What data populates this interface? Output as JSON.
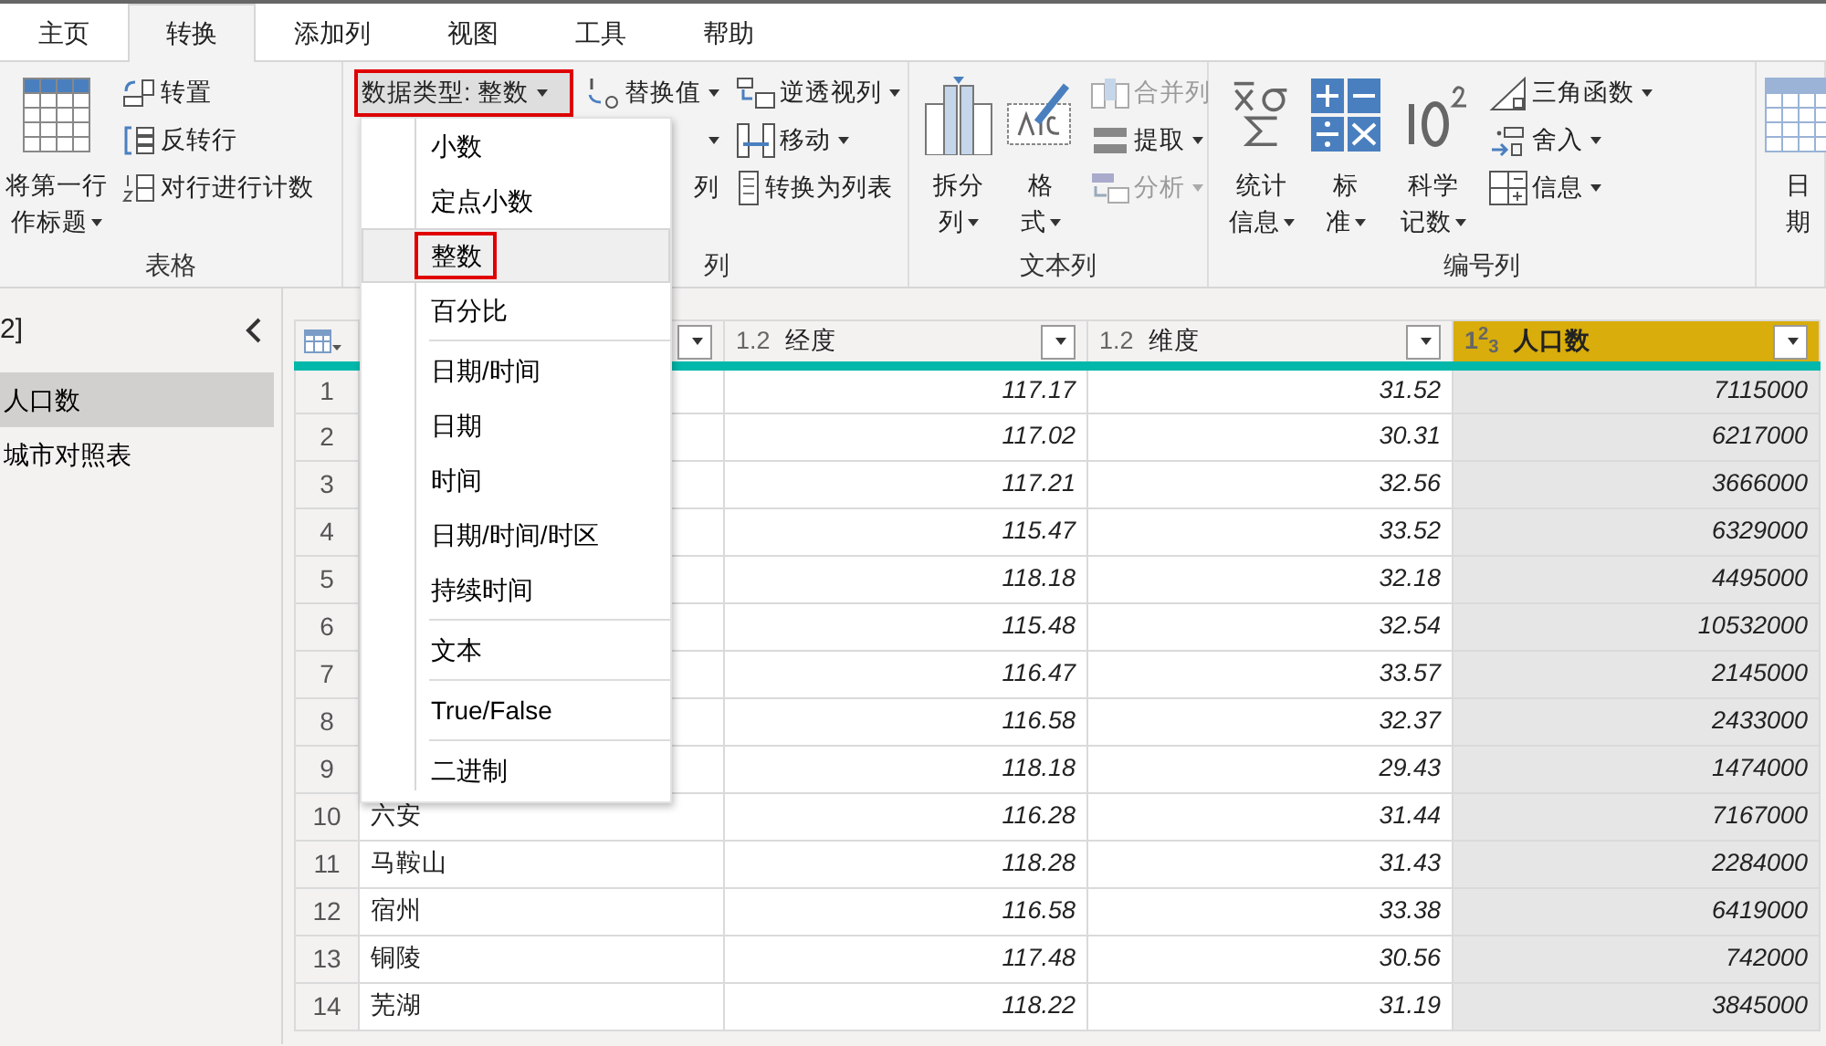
{
  "tabs": [
    {
      "label": "主页",
      "selected": false
    },
    {
      "label": "转换",
      "selected": true
    },
    {
      "label": "添加列",
      "selected": false
    },
    {
      "label": "视图",
      "selected": false
    },
    {
      "label": "工具",
      "selected": false
    },
    {
      "label": "帮助",
      "selected": false
    }
  ],
  "ribbon_groups": [
    {
      "label": "表格",
      "items": [
        {
          "kind": "large",
          "lines": [
            "将第一行",
            "作标题"
          ],
          "caret": true,
          "disabled": false
        },
        {
          "kind": "stack",
          "entries": [
            {
              "label": "转置",
              "caret": false,
              "disabled": false
            },
            {
              "label": "反转行",
              "caret": false,
              "disabled": false
            },
            {
              "label": "对行进行计数",
              "caret": false,
              "disabled": false
            }
          ]
        }
      ]
    },
    {
      "label": "列",
      "items": [
        {
          "kind": "stack",
          "entries": [
            {
              "label": "数据类型: 整数",
              "caret": true,
              "disabled": false,
              "expanded": true,
              "highlighted": true
            }
          ]
        },
        {
          "kind": "stack",
          "entries": [
            {
              "label": "替换值",
              "caret": true,
              "disabled": false
            },
            {
              "caret": true,
              "disabled": false
            },
            {
              "label": "列",
              "caret": false,
              "disabled": false
            }
          ]
        },
        {
          "kind": "stack",
          "entries": [
            {
              "label": "逆透视列",
              "caret": true,
              "disabled": false
            },
            {
              "label": "移动",
              "caret": true,
              "disabled": false
            },
            {
              "label": "转换为列表",
              "caret": false,
              "disabled": false
            }
          ]
        }
      ]
    },
    {
      "label": "文本列",
      "items": [
        {
          "kind": "large",
          "lines": [
            "拆分",
            "列"
          ],
          "caret": true,
          "disabled": false
        },
        {
          "kind": "large",
          "lines": [
            "格",
            "式"
          ],
          "caret": true,
          "disabled": false
        },
        {
          "kind": "stack",
          "entries": [
            {
              "label": "合并列",
              "caret": false,
              "disabled": true
            },
            {
              "label": "提取",
              "caret": true,
              "disabled": false
            },
            {
              "label": "分析",
              "caret": true,
              "disabled": true
            }
          ]
        }
      ]
    },
    {
      "label": "编号列",
      "items": [
        {
          "kind": "large",
          "lines": [
            "统计",
            "信息"
          ],
          "caret": true,
          "disabled": false
        },
        {
          "kind": "large",
          "lines": [
            "标",
            "准"
          ],
          "caret": true,
          "disabled": false
        },
        {
          "kind": "large",
          "lines": [
            "科学",
            "记数"
          ],
          "caret": true,
          "disabled": false
        },
        {
          "kind": "stack",
          "entries": [
            {
              "label": "三角函数",
              "caret": true,
              "disabled": false
            },
            {
              "label": "舍入",
              "caret": true,
              "disabled": false
            },
            {
              "label": "信息",
              "caret": true,
              "disabled": false
            }
          ]
        }
      ]
    },
    {
      "items": [
        {
          "kind": "large",
          "lines": [
            "日",
            "期"
          ],
          "caret": false,
          "disabled": false
        }
      ]
    }
  ],
  "type_menu": [
    {
      "kind": "item",
      "label": "小数",
      "selected": false,
      "highlighted": false
    },
    {
      "kind": "item",
      "label": "定点小数",
      "selected": false,
      "highlighted": false
    },
    {
      "kind": "item",
      "label": "整数",
      "selected": true,
      "highlighted": true
    },
    {
      "kind": "item",
      "label": "百分比",
      "selected": false,
      "highlighted": false
    },
    {
      "kind": "separator"
    },
    {
      "kind": "item",
      "label": "日期/时间",
      "selected": false,
      "highlighted": false
    },
    {
      "kind": "item",
      "label": "日期",
      "selected": false,
      "highlighted": false
    },
    {
      "kind": "item",
      "label": "时间",
      "selected": false,
      "highlighted": false
    },
    {
      "kind": "item",
      "label": "日期/时间/时区",
      "selected": false,
      "highlighted": false
    },
    {
      "kind": "item",
      "label": "持续时间",
      "selected": false,
      "highlighted": false
    },
    {
      "kind": "separator"
    },
    {
      "kind": "item",
      "label": "文本",
      "selected": false,
      "highlighted": false
    },
    {
      "kind": "separator"
    },
    {
      "kind": "item",
      "label": "True/False",
      "selected": false,
      "highlighted": false
    },
    {
      "kind": "separator"
    },
    {
      "kind": "item",
      "label": "二进制",
      "selected": false,
      "highlighted": false
    }
  ],
  "queries_pane": {
    "title": "2]",
    "items": [
      {
        "label": "人口数",
        "selected": true
      },
      {
        "label": "城市对照表",
        "selected": false
      }
    ]
  },
  "table": {
    "columns": [
      {
        "type": "1.2",
        "name": "经度",
        "selected": false
      },
      {
        "type": "1.2",
        "name": "维度",
        "selected": false
      },
      {
        "type": "1$^{2}$$_{3}$",
        "name": "人口数",
        "selected": true
      }
    ],
    "rows": [
      {
        "index": "1",
        "values": [
          "117.17",
          "31.52",
          "7115000"
        ]
      },
      {
        "index": "2",
        "values": [
          "117.02",
          "30.31",
          "6217000"
        ]
      },
      {
        "index": "3",
        "values": [
          "117.21",
          "32.56",
          "3666000"
        ]
      },
      {
        "index": "4",
        "values": [
          "115.47",
          "33.52",
          "6329000"
        ]
      },
      {
        "index": "5",
        "values": [
          "118.18",
          "32.18",
          "4495000"
        ]
      },
      {
        "index": "6",
        "values": [
          "115.48",
          "32.54",
          "10532000"
        ]
      },
      {
        "index": "7",
        "values": [
          "116.47",
          "33.57",
          "2145000"
        ]
      },
      {
        "index": "8",
        "values": [
          "116.58",
          "32.37",
          "2433000"
        ]
      },
      {
        "index": "9",
        "values": [
          "118.18",
          "29.43",
          "1474000"
        ]
      },
      {
        "index": "10",
        "name": "六安",
        "values": [
          "116.28",
          "31.44",
          "7167000"
        ]
      },
      {
        "index": "11",
        "name": "马鞍山",
        "values": [
          "118.28",
          "31.43",
          "2284000"
        ]
      },
      {
        "index": "12",
        "name": "宿州",
        "values": [
          "116.58",
          "33.38",
          "6419000"
        ]
      },
      {
        "index": "13",
        "name": "铜陵",
        "values": [
          "117.48",
          "30.56",
          "742000"
        ]
      },
      {
        "index": "14",
        "name": "芜湖",
        "values": [
          "118.22",
          "31.19",
          "3845000"
        ]
      }
    ]
  }
}
